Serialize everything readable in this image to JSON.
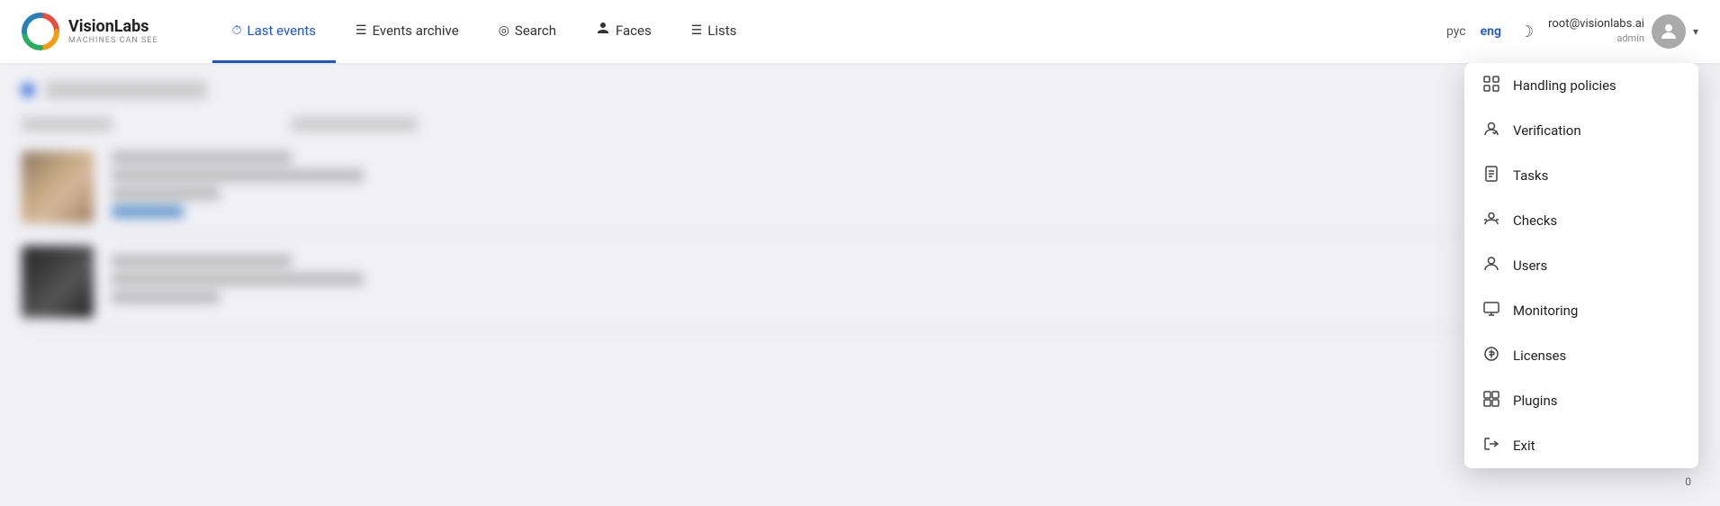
{
  "logo": {
    "name": "VisionLabs",
    "tagline": "MACHINES CAN SEE"
  },
  "nav": {
    "items": [
      {
        "id": "last-events",
        "label": "Last events",
        "icon": "⏱",
        "active": true
      },
      {
        "id": "events-archive",
        "label": "Events archive",
        "icon": "≡",
        "active": false
      },
      {
        "id": "search",
        "label": "Search",
        "icon": "◎",
        "active": false
      },
      {
        "id": "faces",
        "label": "Faces",
        "icon": "👤",
        "active": false
      },
      {
        "id": "lists",
        "label": "Lists",
        "icon": "≡",
        "active": false
      }
    ]
  },
  "language": {
    "options": [
      "рус",
      "eng"
    ],
    "active": "eng"
  },
  "user": {
    "email": "root@visionlabs.ai",
    "role": "admin"
  },
  "dropdown": {
    "items": [
      {
        "id": "handling-policies",
        "label": "Handling policies",
        "icon": "grid"
      },
      {
        "id": "verification",
        "label": "Verification",
        "icon": "person-check"
      },
      {
        "id": "tasks",
        "label": "Tasks",
        "icon": "document"
      },
      {
        "id": "checks",
        "label": "Checks",
        "icon": "person-list"
      },
      {
        "id": "users",
        "label": "Users",
        "icon": "person"
      },
      {
        "id": "monitoring",
        "label": "Monitoring",
        "icon": "monitor"
      },
      {
        "id": "licenses",
        "label": "Licenses",
        "icon": "dollar"
      },
      {
        "id": "plugins",
        "label": "Plugins",
        "icon": "grid-four"
      },
      {
        "id": "exit",
        "label": "Exit",
        "icon": "exit"
      }
    ]
  },
  "counter": "0"
}
